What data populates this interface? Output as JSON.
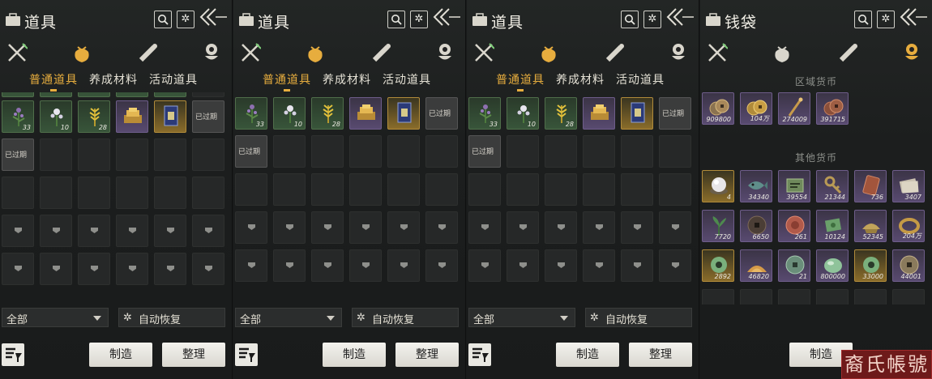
{
  "panels": [
    {
      "title": "道具",
      "subtabs": [
        "普通道具",
        "养成材料",
        "活动道具"
      ],
      "active_category": 1,
      "grid": [
        {
          "rarity": "green",
          "art": "herb-purple",
          "qty": "33"
        },
        {
          "rarity": "green",
          "art": "flower-white",
          "qty": "10"
        },
        {
          "rarity": "green",
          "art": "wheat",
          "qty": "28"
        },
        {
          "rarity": "purple",
          "art": "gold-bars",
          "qty": ""
        },
        {
          "rarity": "gold",
          "art": "card",
          "qty": ""
        },
        {
          "rarity": "grey",
          "art": "",
          "qty": "",
          "expired": "已过期"
        },
        {
          "rarity": "grey",
          "art": "",
          "qty": "",
          "expired": "已过期"
        }
      ],
      "footer": {
        "filter_all": "全部",
        "auto_restore": "自动恢复",
        "make": "制造",
        "sort": "整理"
      }
    },
    {
      "title": "道具",
      "subtabs": [
        "普通道具",
        "养成材料",
        "活动道具"
      ],
      "active_category": 1,
      "grid": [
        {
          "rarity": "green",
          "art": "herb-purple",
          "qty": "33"
        },
        {
          "rarity": "green",
          "art": "flower-white",
          "qty": "10"
        },
        {
          "rarity": "green",
          "art": "wheat",
          "qty": "28"
        },
        {
          "rarity": "purple",
          "art": "gold-bars",
          "qty": ""
        },
        {
          "rarity": "gold",
          "art": "card",
          "qty": ""
        },
        {
          "rarity": "grey",
          "art": "",
          "qty": "",
          "expired": "已过期"
        },
        {
          "rarity": "grey",
          "art": "",
          "qty": "",
          "expired": "已过期"
        }
      ],
      "footer": {
        "filter_all": "全部",
        "auto_restore": "自动恢复",
        "make": "制造",
        "sort": "整理"
      }
    },
    {
      "title": "道具",
      "subtabs": [
        "普通道具",
        "养成材料",
        "活动道具"
      ],
      "active_category": 1,
      "grid": [
        {
          "rarity": "green",
          "art": "herb-purple",
          "qty": "33"
        },
        {
          "rarity": "green",
          "art": "flower-white",
          "qty": "10"
        },
        {
          "rarity": "green",
          "art": "wheat",
          "qty": "28"
        },
        {
          "rarity": "purple",
          "art": "gold-bars",
          "qty": ""
        },
        {
          "rarity": "gold",
          "art": "card",
          "qty": ""
        },
        {
          "rarity": "grey",
          "art": "",
          "qty": "",
          "expired": "已过期"
        },
        {
          "rarity": "grey",
          "art": "",
          "qty": "",
          "expired": "已过期"
        }
      ],
      "footer": {
        "filter_all": "全部",
        "auto_restore": "自动恢复",
        "make": "制造",
        "sort": "整理"
      }
    },
    {
      "title": "钱袋",
      "active_category": 3,
      "region_label": "区域货币",
      "other_label": "其他货币",
      "region": [
        {
          "rarity": "purple",
          "art": "coins",
          "qty": "909800"
        },
        {
          "rarity": "purple",
          "art": "coins-gold",
          "qty": "104万"
        },
        {
          "rarity": "purple",
          "art": "pin",
          "qty": "274009"
        },
        {
          "rarity": "purple",
          "art": "coins-copper",
          "qty": "391715"
        }
      ],
      "other": [
        {
          "rarity": "gold",
          "art": "pearl",
          "qty": "4"
        },
        {
          "rarity": "purple",
          "art": "fish",
          "qty": "34340"
        },
        {
          "rarity": "purple",
          "art": "ticket",
          "qty": "39554"
        },
        {
          "rarity": "purple",
          "art": "key",
          "qty": "21344"
        },
        {
          "rarity": "purple",
          "art": "tablet",
          "qty": "736"
        },
        {
          "rarity": "purple",
          "art": "notes",
          "qty": "3407"
        },
        {
          "rarity": "purple",
          "art": "plant",
          "qty": "7720"
        },
        {
          "rarity": "purple",
          "art": "coin-dark",
          "qty": "6650"
        },
        {
          "rarity": "purple",
          "art": "coin-red",
          "qty": "261"
        },
        {
          "rarity": "purple",
          "art": "cash",
          "qty": "10124"
        },
        {
          "rarity": "purple",
          "art": "ingot",
          "qty": "52345"
        },
        {
          "rarity": "purple",
          "art": "bracelet",
          "qty": "204万"
        },
        {
          "rarity": "gold",
          "art": "jade-ring",
          "qty": "2892"
        },
        {
          "rarity": "purple",
          "art": "sand",
          "qty": "46820"
        },
        {
          "rarity": "purple",
          "art": "coin-green",
          "qty": "21"
        },
        {
          "rarity": "purple",
          "art": "jade",
          "qty": "800000"
        },
        {
          "rarity": "gold",
          "art": "jade-ring",
          "qty": "33000"
        },
        {
          "rarity": "purple",
          "art": "coin-bronze",
          "qty": "44001"
        }
      ],
      "footer": {
        "make": "制造"
      }
    }
  ],
  "watermark": "裔氏帳號",
  "colors": {
    "accent": "#e7ad3e",
    "green_rarity": "#38553a",
    "purple_rarity": "#584a70",
    "gold_rarity": "#8a6c2a",
    "background": "#1c1e1e"
  }
}
